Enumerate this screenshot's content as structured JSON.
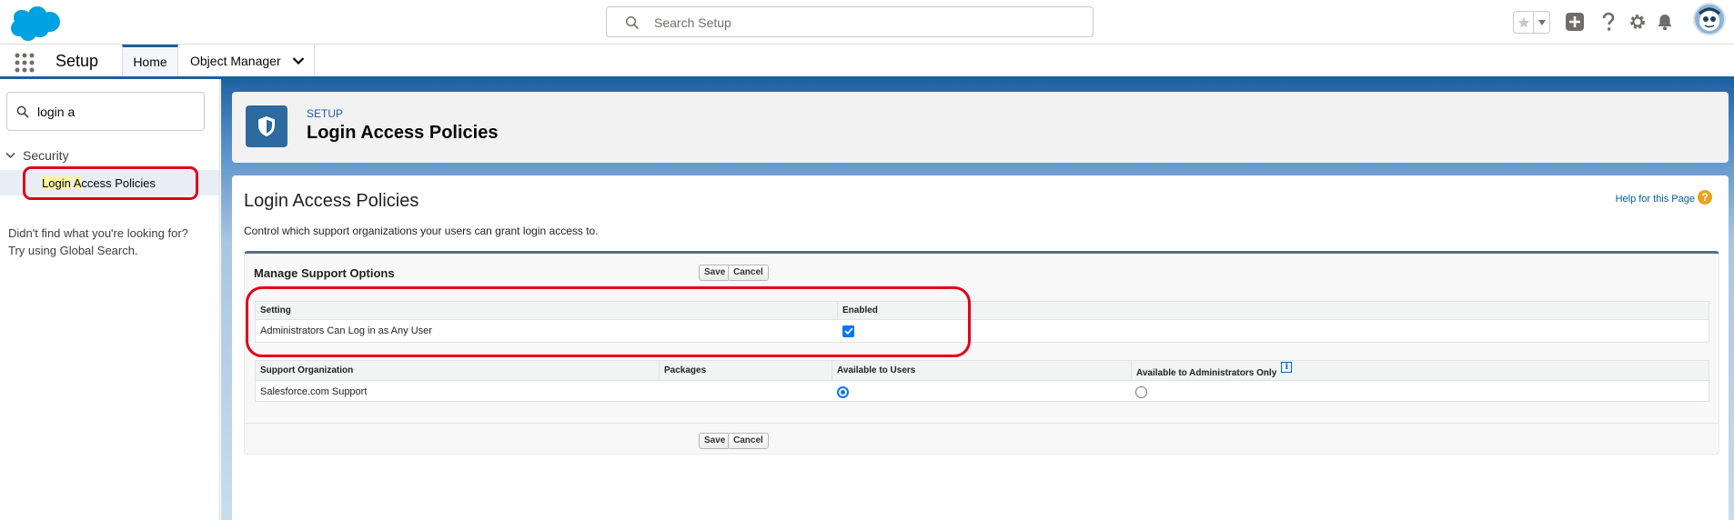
{
  "header": {
    "search_placeholder": "Search Setup",
    "icons": [
      "favorites-star-icon",
      "favorites-dropdown-icon",
      "global-actions-icon",
      "help-icon",
      "setup-gear-icon",
      "notifications-bell-icon",
      "avatar"
    ]
  },
  "nav": {
    "app_name": "Setup",
    "tabs": [
      {
        "label": "Home",
        "active": true
      },
      {
        "label": "Object Manager",
        "active": false
      }
    ]
  },
  "sidebar": {
    "quick_find_value": "login a",
    "section_label": "Security",
    "item_label_match1": "Login",
    "item_label_space": " ",
    "item_label_match2": "A",
    "item_label_rest": "ccess Policies",
    "help_line1": "Didn't find what you're looking for?",
    "help_line2": "Try using Global Search."
  },
  "page_header": {
    "eyebrow": "SETUP",
    "title": "Login Access Policies"
  },
  "content": {
    "title": "Login Access Policies",
    "help_link": "Help for this Page",
    "help_icon": "?",
    "description": "Control which support organizations your users can grant login access to.",
    "block_title": "Manage Support Options",
    "save_label": "Save",
    "cancel_label": "Cancel",
    "settings_table": {
      "headers": [
        "Setting",
        "Enabled"
      ],
      "row": {
        "setting": "Administrators Can Log in as Any User",
        "enabled": true
      }
    },
    "org_table": {
      "headers": [
        "Support Organization",
        "Packages",
        "Available to Users",
        "Available to Administrators Only"
      ],
      "info_icon": "i",
      "row": {
        "org": "Salesforce.com Support",
        "packages": "",
        "available_to_users": true,
        "admins_only": false
      }
    }
  },
  "colors": {
    "brand_blue": "#1b5f9e",
    "highlight_red": "#e2001a",
    "search_highlight": "#fbf59f"
  }
}
